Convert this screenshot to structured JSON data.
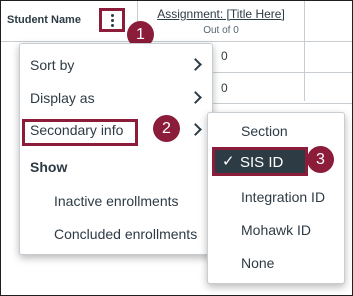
{
  "grid": {
    "student_header": "Student Name",
    "assignment_title": "Assignment: [Title Here]",
    "assignment_points": "Out of 0",
    "cells": [
      "0",
      "0"
    ]
  },
  "callouts": [
    "1",
    "2",
    "3"
  ],
  "menu": {
    "items": [
      {
        "label": "Sort by"
      },
      {
        "label": "Display as"
      },
      {
        "label": "Secondary info"
      }
    ],
    "show_heading": "Show",
    "show_items": [
      "Inactive enrollments",
      "Concluded enrollments"
    ]
  },
  "submenu": {
    "items": [
      "Section",
      "SIS ID",
      "Integration ID",
      "Mohawk ID",
      "None"
    ],
    "selected": "SIS ID",
    "check_glyph": "✓"
  },
  "colors": {
    "callout": "#8b1c3a",
    "selected_bg": "#2d3b45",
    "text": "#2d3b45"
  }
}
